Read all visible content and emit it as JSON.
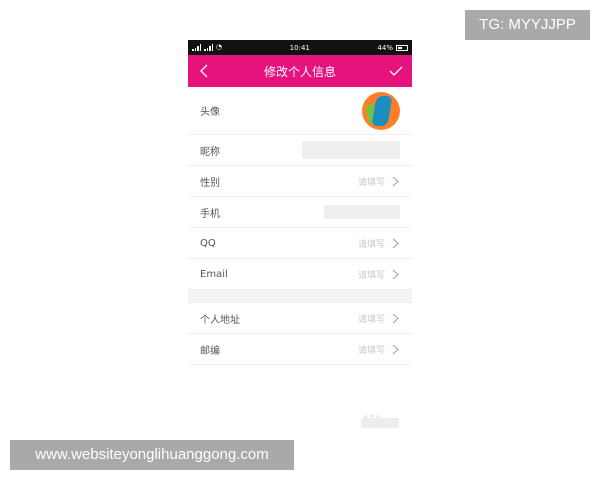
{
  "watermarks": {
    "top": "TG: MYYJJPP",
    "bottom": "www.websiteyonglihuanggong.com"
  },
  "status_bar": {
    "time": "10:41",
    "battery": "44%"
  },
  "title_bar": {
    "title": "修改个人信息",
    "back_icon": "chevron-left-icon",
    "confirm_icon": "check-icon",
    "accent": "#e6137f"
  },
  "rows": {
    "avatar": {
      "label": "头像"
    },
    "nickname": {
      "label": "昵称"
    },
    "gender": {
      "label": "性别",
      "placeholder": "请填写"
    },
    "phone": {
      "label": "手机"
    },
    "qq": {
      "label": "QQ",
      "placeholder": "请填写"
    },
    "email": {
      "label": "Email",
      "placeholder": "请填写"
    },
    "address": {
      "label": "个人地址",
      "placeholder": "请填写"
    },
    "postcode": {
      "label": "邮编",
      "placeholder": "请填写"
    }
  }
}
